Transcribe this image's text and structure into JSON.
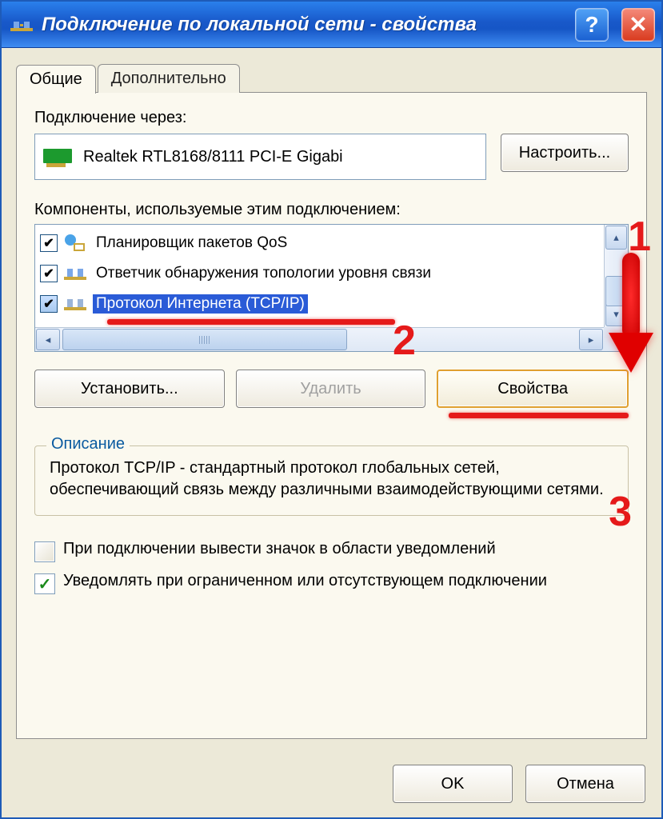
{
  "title": "Подключение по локальной сети - свойства",
  "tabs": {
    "general": "Общие",
    "advanced": "Дополнительно"
  },
  "connectVia": {
    "label": "Подключение через:",
    "adapter": "Realtek RTL8168/8111 PCI-E Gigabi",
    "configure": "Настроить..."
  },
  "components": {
    "label": "Компоненты, используемые этим подключением:",
    "items": [
      {
        "checked": true,
        "icon": "qos",
        "label": "Планировщик пакетов QoS",
        "selected": false
      },
      {
        "checked": true,
        "icon": "lltd",
        "label": "Ответчик обнаружения топологии уровня связи",
        "selected": false
      },
      {
        "checked": true,
        "icon": "tcpip",
        "label": "Протокол Интернета (TCP/IP)",
        "selected": true
      }
    ]
  },
  "buttons": {
    "install": "Установить...",
    "uninstall": "Удалить",
    "properties": "Свойства"
  },
  "description": {
    "legend": "Описание",
    "text": "Протокол TCP/IP - стандартный протокол глобальных сетей, обеспечивающий связь между различными взаимодействующими сетями."
  },
  "options": {
    "showIcon": {
      "checked": false,
      "label": "При подключении вывести значок в области уведомлений"
    },
    "notifyLimited": {
      "checked": true,
      "label": "Уведомлять при ограниченном или отсутствующем подключении"
    }
  },
  "dialog": {
    "ok": "OK",
    "cancel": "Отмена"
  },
  "annotations": {
    "n1": "1",
    "n2": "2",
    "n3": "3"
  }
}
